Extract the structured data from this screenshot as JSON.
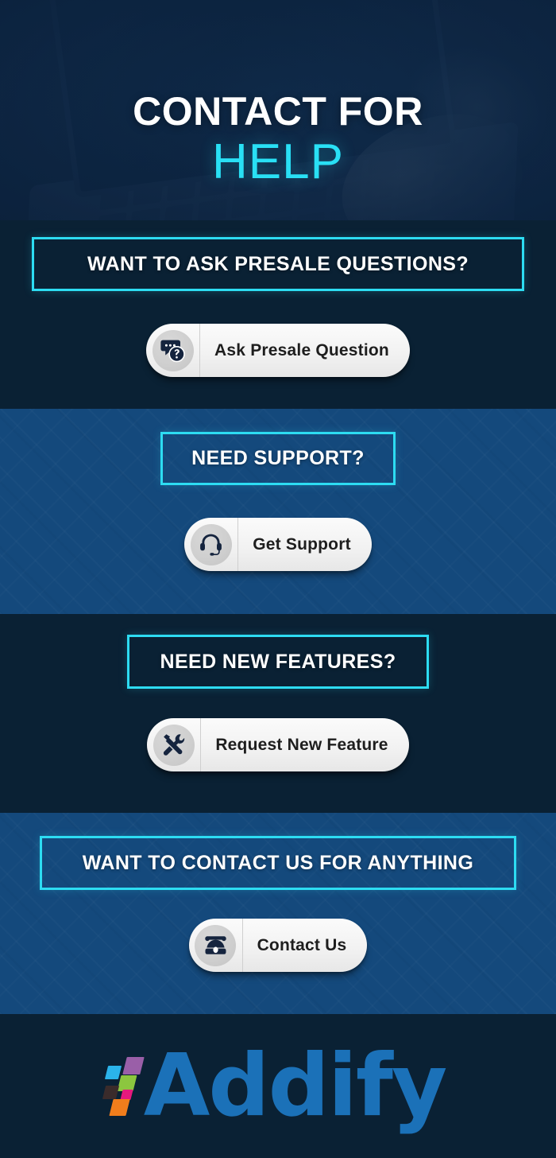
{
  "hero": {
    "title_line1": "CONTACT FOR",
    "title_line2": "HELP",
    "background_image": "laptop-typing-photo",
    "tint_color": "#112e4f",
    "accent_color": "#29e0f5"
  },
  "theme": {
    "dark_section_bg": "#0a2134",
    "blue_section_bg": "#14497c",
    "cyan_accent": "#2ddcf2",
    "button_bg": "#f2f2f2",
    "button_text": "#1e1e1e",
    "logo_blue": "#1b71b8"
  },
  "sections": [
    {
      "heading": "WANT TO ASK PRESALE QUESTIONS?",
      "button_label": "Ask Presale Question",
      "icon": "question-chat-bubble-icon",
      "style": "dark"
    },
    {
      "heading": "NEED SUPPORT?",
      "button_label": "Get Support",
      "icon": "headset-icon",
      "style": "blue"
    },
    {
      "heading": "NEED NEW FEATURES?",
      "button_label": "Request New Feature",
      "icon": "wrench-screwdriver-icon",
      "style": "dark"
    },
    {
      "heading": "WANT TO CONTACT US FOR ANYTHING",
      "button_label": "Contact Us",
      "icon": "rotary-telephone-icon",
      "style": "blue"
    }
  ],
  "footer": {
    "brand_name": "Addify",
    "mark_colors": [
      "#2bb3ea",
      "#9a5fa8",
      "#8cc63f",
      "#3a2b2b",
      "#e6197d",
      "#f07d1c"
    ]
  }
}
